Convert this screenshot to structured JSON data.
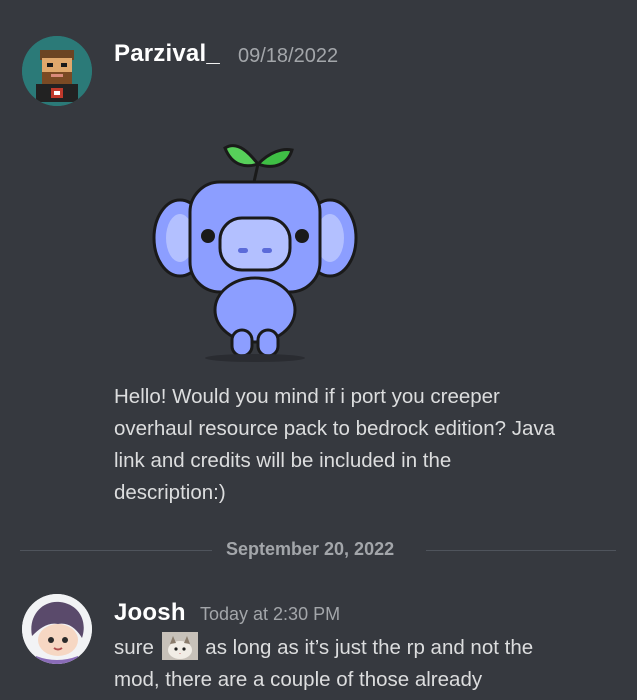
{
  "messages": [
    {
      "username": "Parzival_",
      "timestamp": "09/18/2022",
      "text": "Hello! Would you mind if i port you creeper overhaul resource pack to bedrock edition? Java link and credits will be included in the description:)",
      "lines": [
        "Hello! Would you mind if i port you creeper",
        "overhaul resource pack to bedrock edition? Java",
        "link and credits will be included in the",
        "description:)"
      ],
      "sticker": "wumpus-leaf-sticker",
      "avatar_icon": "bearded-blocky-avatar-icon"
    },
    {
      "username": "Joosh",
      "timestamp": "Today at 2:30 PM",
      "line1_before": "sure",
      "line1_emoji": "cat-emoji",
      "line1_after": "as long as it’s just the rp and not the",
      "line2": "mod, there are a couple of those already",
      "avatar_icon": "anime-character-avatar-icon"
    }
  ],
  "separator": {
    "date": "September 20, 2022"
  },
  "colors": {
    "background": "#36393f",
    "username": "#ffffff",
    "text": "#dcddde",
    "muted": "#a3a6aa",
    "wumpus": "#8c9eff"
  }
}
